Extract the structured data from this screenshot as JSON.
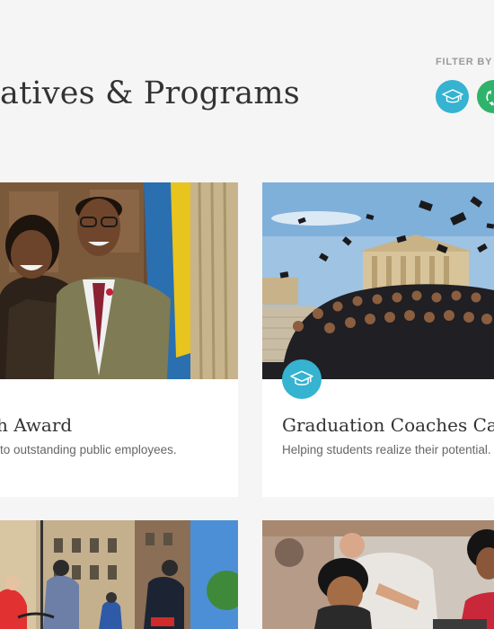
{
  "header": {
    "title": "atives & Programs",
    "filter_label": "FILTER BY I",
    "filters": [
      {
        "icon": "graduation-cap-icon",
        "color": "#35b3d1"
      },
      {
        "icon": "recycle-icon",
        "color": "#2fb36a"
      }
    ]
  },
  "cards": [
    {
      "title": "h Award",
      "description": "to outstanding public employees."
    },
    {
      "title": "Graduation Coaches Ca",
      "description": "Helping students realize their potential.",
      "badge_icon": "graduation-cap-icon"
    },
    {
      "title": "",
      "description": ""
    },
    {
      "title": "",
      "description": ""
    }
  ],
  "colors": {
    "background": "#f5f5f5",
    "education_blue": "#35b3d1",
    "environment_green": "#2fb36a",
    "text_dark": "#333333",
    "text_muted": "#666666"
  }
}
